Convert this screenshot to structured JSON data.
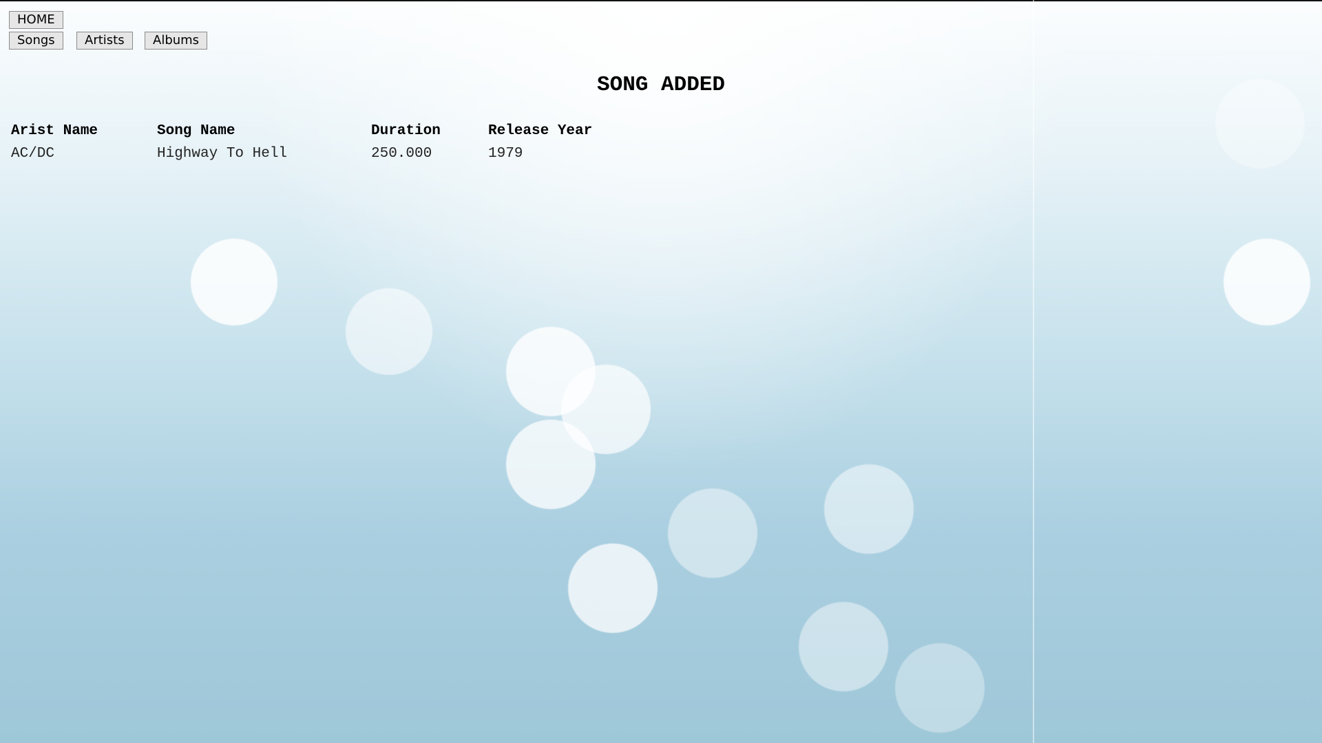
{
  "nav": {
    "home_label": "HOME",
    "songs_label": "Songs",
    "artists_label": "Artists",
    "albums_label": "Albums"
  },
  "page_title": "SONG ADDED",
  "table": {
    "headers": [
      "Arist Name",
      "Song Name",
      "Duration",
      "Release Year"
    ],
    "rows": [
      [
        "AC/DC",
        "Highway To Hell",
        "250.000",
        "1979"
      ]
    ]
  }
}
